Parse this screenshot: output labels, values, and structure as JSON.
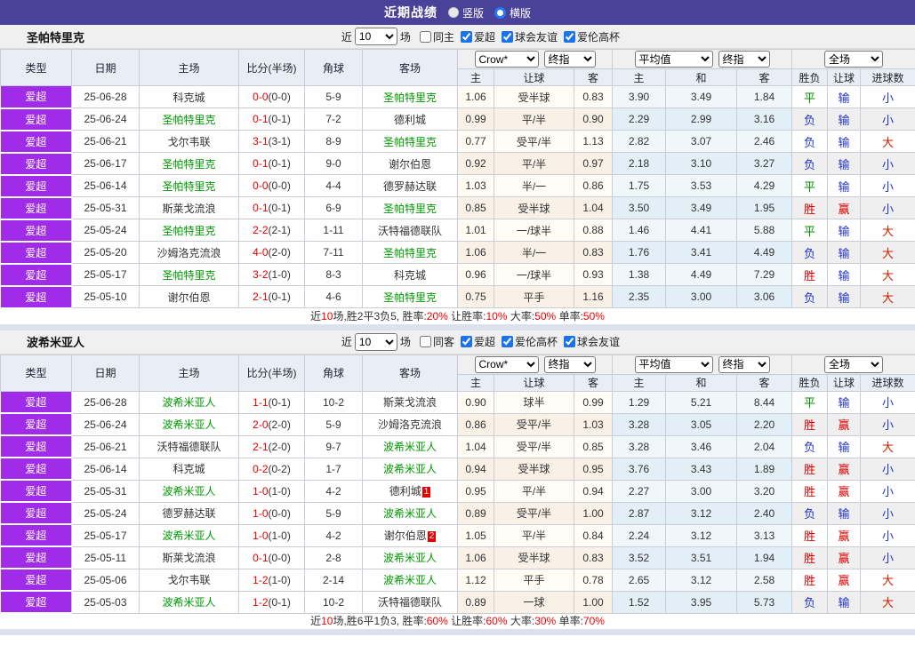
{
  "banner": {
    "title": "近期战绩",
    "options": [
      {
        "label": "竖版",
        "selected": true
      },
      {
        "label": "横版",
        "selected": false
      }
    ]
  },
  "filter_labels": {
    "near": "近",
    "count": "10",
    "games": "场"
  },
  "table_header": {
    "cols": [
      "类型",
      "日期",
      "主场",
      "比分(半场)",
      "角球",
      "客场"
    ],
    "odds_source": "Crow*",
    "final_label": "终指",
    "avg_label": "平均值",
    "final_label2": "终指",
    "scope_label": "全场",
    "odds_sub": [
      "主",
      "让球",
      "客"
    ],
    "avg_sub": [
      "主",
      "和",
      "客"
    ],
    "result_sub": [
      "胜负",
      "让球",
      "进球数"
    ]
  },
  "result_colors": {
    "胜": "#dd0000",
    "平": "#008800",
    "负": "#2233cc",
    "赢": "#dd0000",
    "输": "#2233cc",
    "大": "#cc2200",
    "小": "#2233cc"
  },
  "sections": [
    {
      "team": "圣帕特里克",
      "checkboxes": [
        {
          "label": "同主",
          "checked": false
        },
        {
          "label": "爱超",
          "checked": true
        },
        {
          "label": "球会友谊",
          "checked": true
        },
        {
          "label": "爱伦高杯",
          "checked": true
        }
      ],
      "rows": [
        {
          "t": "爱超",
          "d": "25-06-28",
          "h": "科克城",
          "hg": 0,
          "s": "0-0",
          "hf": "(0-0)",
          "c": "5-9",
          "a": "圣帕特里克",
          "ag": 1,
          "ab": "",
          "o": [
            "1.06",
            "受半球",
            "0.83"
          ],
          "v": [
            "3.90",
            "3.49",
            "1.84"
          ],
          "r": [
            "平",
            "输",
            "小"
          ]
        },
        {
          "t": "爱超",
          "d": "25-06-24",
          "h": "圣帕特里克",
          "hg": 1,
          "s": "0-1",
          "hf": "(0-1)",
          "c": "7-2",
          "a": "德利城",
          "ag": 0,
          "ab": "",
          "o": [
            "0.99",
            "平/半",
            "0.90"
          ],
          "v": [
            "2.29",
            "2.99",
            "3.16"
          ],
          "r": [
            "负",
            "输",
            "小"
          ]
        },
        {
          "t": "爱超",
          "d": "25-06-21",
          "h": "戈尔韦联",
          "hg": 0,
          "s": "3-1",
          "hf": "(3-1)",
          "c": "8-9",
          "a": "圣帕特里克",
          "ag": 1,
          "ab": "",
          "o": [
            "0.77",
            "受平/半",
            "1.13"
          ],
          "v": [
            "2.82",
            "3.07",
            "2.46"
          ],
          "r": [
            "负",
            "输",
            "大"
          ]
        },
        {
          "t": "爱超",
          "d": "25-06-17",
          "h": "圣帕特里克",
          "hg": 1,
          "s": "0-1",
          "hf": "(0-1)",
          "c": "9-0",
          "a": "谢尔伯恩",
          "ag": 0,
          "ab": "",
          "o": [
            "0.92",
            "平/半",
            "0.97"
          ],
          "v": [
            "2.18",
            "3.10",
            "3.27"
          ],
          "r": [
            "负",
            "输",
            "小"
          ]
        },
        {
          "t": "爱超",
          "d": "25-06-14",
          "h": "圣帕特里克",
          "hg": 1,
          "s": "0-0",
          "hf": "(0-0)",
          "c": "4-4",
          "a": "德罗赫达联",
          "ag": 0,
          "ab": "",
          "o": [
            "1.03",
            "半/一",
            "0.86"
          ],
          "v": [
            "1.75",
            "3.53",
            "4.29"
          ],
          "r": [
            "平",
            "输",
            "小"
          ]
        },
        {
          "t": "爱超",
          "d": "25-05-31",
          "h": "斯莱戈流浪",
          "hg": 0,
          "s": "0-1",
          "hf": "(0-1)",
          "c": "6-9",
          "a": "圣帕特里克",
          "ag": 1,
          "ab": "",
          "o": [
            "0.85",
            "受半球",
            "1.04"
          ],
          "v": [
            "3.50",
            "3.49",
            "1.95"
          ],
          "r": [
            "胜",
            "赢",
            "小"
          ]
        },
        {
          "t": "爱超",
          "d": "25-05-24",
          "h": "圣帕特里克",
          "hg": 1,
          "s": "2-2",
          "hf": "(2-1)",
          "c": "1-11",
          "a": "沃特福德联队",
          "ag": 0,
          "ab": "",
          "o": [
            "1.01",
            "一/球半",
            "0.88"
          ],
          "v": [
            "1.46",
            "4.41",
            "5.88"
          ],
          "r": [
            "平",
            "输",
            "大"
          ]
        },
        {
          "t": "爱超",
          "d": "25-05-20",
          "h": "沙姆洛克流浪",
          "hg": 0,
          "s": "4-0",
          "hf": "(2-0)",
          "c": "7-11",
          "a": "圣帕特里克",
          "ag": 1,
          "ab": "",
          "o": [
            "1.06",
            "半/一",
            "0.83"
          ],
          "v": [
            "1.76",
            "3.41",
            "4.49"
          ],
          "r": [
            "负",
            "输",
            "大"
          ]
        },
        {
          "t": "爱超",
          "d": "25-05-17",
          "h": "圣帕特里克",
          "hg": 1,
          "s": "3-2",
          "hf": "(1-0)",
          "c": "8-3",
          "a": "科克城",
          "ag": 0,
          "ab": "",
          "o": [
            "0.96",
            "一/球半",
            "0.93"
          ],
          "v": [
            "1.38",
            "4.49",
            "7.29"
          ],
          "r": [
            "胜",
            "输",
            "大"
          ]
        },
        {
          "t": "爱超",
          "d": "25-05-10",
          "h": "谢尔伯恩",
          "hg": 0,
          "s": "2-1",
          "hf": "(0-1)",
          "c": "4-6",
          "a": "圣帕特里克",
          "ag": 1,
          "ab": "",
          "o": [
            "0.75",
            "平手",
            "1.16"
          ],
          "v": [
            "2.35",
            "3.00",
            "3.06"
          ],
          "r": [
            "负",
            "输",
            "大"
          ]
        }
      ],
      "summary": [
        "近",
        "10",
        "场,胜2平3负5, 胜率:",
        "20%",
        " 让胜率:",
        "10%",
        " 大率:",
        "50%",
        " 单率:",
        "50%"
      ]
    },
    {
      "team": "波希米亚人",
      "checkboxes": [
        {
          "label": "同客",
          "checked": false
        },
        {
          "label": "爱超",
          "checked": true
        },
        {
          "label": "爱伦高杯",
          "checked": true
        },
        {
          "label": "球会友谊",
          "checked": true
        }
      ],
      "rows": [
        {
          "t": "爱超",
          "d": "25-06-28",
          "h": "波希米亚人",
          "hg": 1,
          "s": "1-1",
          "hf": "(0-1)",
          "c": "10-2",
          "a": "斯莱戈流浪",
          "ag": 0,
          "ab": "",
          "o": [
            "0.90",
            "球半",
            "0.99"
          ],
          "v": [
            "1.29",
            "5.21",
            "8.44"
          ],
          "r": [
            "平",
            "输",
            "小"
          ]
        },
        {
          "t": "爱超",
          "d": "25-06-24",
          "h": "波希米亚人",
          "hg": 1,
          "s": "2-0",
          "hf": "(2-0)",
          "c": "5-9",
          "a": "沙姆洛克流浪",
          "ag": 0,
          "ab": "",
          "o": [
            "0.86",
            "受平/半",
            "1.03"
          ],
          "v": [
            "3.28",
            "3.05",
            "2.20"
          ],
          "r": [
            "胜",
            "赢",
            "小"
          ]
        },
        {
          "t": "爱超",
          "d": "25-06-21",
          "h": "沃特福德联队",
          "hg": 0,
          "s": "2-1",
          "hf": "(2-0)",
          "c": "9-7",
          "a": "波希米亚人",
          "ag": 1,
          "ab": "",
          "o": [
            "1.04",
            "受平/半",
            "0.85"
          ],
          "v": [
            "3.28",
            "3.46",
            "2.04"
          ],
          "r": [
            "负",
            "输",
            "大"
          ]
        },
        {
          "t": "爱超",
          "d": "25-06-14",
          "h": "科克城",
          "hg": 0,
          "s": "0-2",
          "hf": "(0-2)",
          "c": "1-7",
          "a": "波希米亚人",
          "ag": 1,
          "ab": "",
          "o": [
            "0.94",
            "受半球",
            "0.95"
          ],
          "v": [
            "3.76",
            "3.43",
            "1.89"
          ],
          "r": [
            "胜",
            "赢",
            "小"
          ]
        },
        {
          "t": "爱超",
          "d": "25-05-31",
          "h": "波希米亚人",
          "hg": 1,
          "s": "1-0",
          "hf": "(1-0)",
          "c": "4-2",
          "a": "德利城",
          "ag": 0,
          "ab": "1",
          "o": [
            "0.95",
            "平/半",
            "0.94"
          ],
          "v": [
            "2.27",
            "3.00",
            "3.20"
          ],
          "r": [
            "胜",
            "赢",
            "小"
          ]
        },
        {
          "t": "爱超",
          "d": "25-05-24",
          "h": "德罗赫达联",
          "hg": 0,
          "s": "1-0",
          "hf": "(0-0)",
          "c": "5-9",
          "a": "波希米亚人",
          "ag": 1,
          "ab": "",
          "o": [
            "0.89",
            "受平/半",
            "1.00"
          ],
          "v": [
            "2.87",
            "3.12",
            "2.40"
          ],
          "r": [
            "负",
            "输",
            "小"
          ]
        },
        {
          "t": "爱超",
          "d": "25-05-17",
          "h": "波希米亚人",
          "hg": 1,
          "s": "1-0",
          "hf": "(1-0)",
          "c": "4-2",
          "a": "谢尔伯恩",
          "ag": 0,
          "ab": "2",
          "o": [
            "1.05",
            "平/半",
            "0.84"
          ],
          "v": [
            "2.24",
            "3.12",
            "3.13"
          ],
          "r": [
            "胜",
            "赢",
            "小"
          ]
        },
        {
          "t": "爱超",
          "d": "25-05-11",
          "h": "斯莱戈流浪",
          "hg": 0,
          "s": "0-1",
          "hf": "(0-0)",
          "c": "2-8",
          "a": "波希米亚人",
          "ag": 1,
          "ab": "",
          "o": [
            "1.06",
            "受半球",
            "0.83"
          ],
          "v": [
            "3.52",
            "3.51",
            "1.94"
          ],
          "r": [
            "胜",
            "赢",
            "小"
          ]
        },
        {
          "t": "爱超",
          "d": "25-05-06",
          "h": "戈尔韦联",
          "hg": 0,
          "s": "1-2",
          "hf": "(1-0)",
          "c": "2-14",
          "a": "波希米亚人",
          "ag": 1,
          "ab": "",
          "o": [
            "1.12",
            "平手",
            "0.78"
          ],
          "v": [
            "2.65",
            "3.12",
            "2.58"
          ],
          "r": [
            "胜",
            "赢",
            "大"
          ]
        },
        {
          "t": "爱超",
          "d": "25-05-03",
          "h": "波希米亚人",
          "hg": 1,
          "s": "1-2",
          "hf": "(0-1)",
          "c": "10-2",
          "a": "沃特福德联队",
          "ag": 0,
          "ab": "",
          "o": [
            "0.89",
            "一球",
            "1.00"
          ],
          "v": [
            "1.52",
            "3.95",
            "5.73"
          ],
          "r": [
            "负",
            "输",
            "大"
          ]
        }
      ],
      "summary": [
        "近",
        "10",
        "场,胜6平1负3, 胜率:",
        "60%",
        " 让胜率:",
        "60%",
        " 大率:",
        "30%",
        " 单率:",
        "70%"
      ]
    }
  ]
}
